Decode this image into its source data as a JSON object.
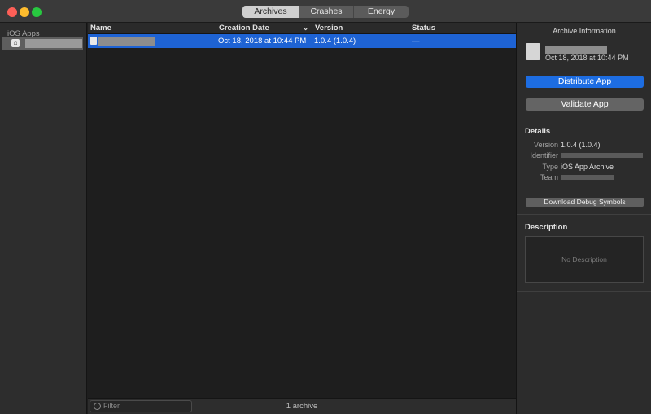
{
  "window": {
    "tabs": [
      {
        "label": "Archives",
        "active": true
      },
      {
        "label": "Crashes",
        "active": false
      },
      {
        "label": "Energy",
        "active": false
      }
    ]
  },
  "sidebar": {
    "section_title": "iOS Apps",
    "items": [
      {
        "label": "",
        "redacted": true,
        "selected": true,
        "icon": "app-icon"
      }
    ]
  },
  "table": {
    "columns": [
      "Name",
      "Creation Date",
      "Version",
      "Status"
    ],
    "sorted_column": "Creation Date",
    "rows": [
      {
        "name": "",
        "name_redacted": true,
        "creation_date": "Oct 18, 2018 at 10:44 PM",
        "version": "1.0.4 (1.0.4)",
        "status": "—",
        "selected": true
      }
    ]
  },
  "footer": {
    "filter_placeholder": "Filter",
    "archive_count": "1 archive"
  },
  "inspector": {
    "title": "Archive Information",
    "archive": {
      "name": "",
      "name_redacted": true,
      "date": "Oct 18, 2018 at 10:44 PM"
    },
    "buttons": {
      "distribute": "Distribute App",
      "validate": "Validate App",
      "debug_symbols": "Download Debug Symbols"
    },
    "details": {
      "title": "Details",
      "version_label": "Version",
      "version_value": "1.0.4 (1.0.4)",
      "identifier_label": "Identifier",
      "identifier_value": "",
      "type_label": "Type",
      "type_value": "iOS App Archive",
      "team_label": "Team",
      "team_value": ""
    },
    "description": {
      "title": "Description",
      "placeholder": "No Description"
    }
  },
  "colors": {
    "accent": "#1d6de2",
    "selection": "#1e63d4",
    "close": "#fe5f57",
    "minimize": "#febc2e",
    "zoom": "#28c840"
  }
}
